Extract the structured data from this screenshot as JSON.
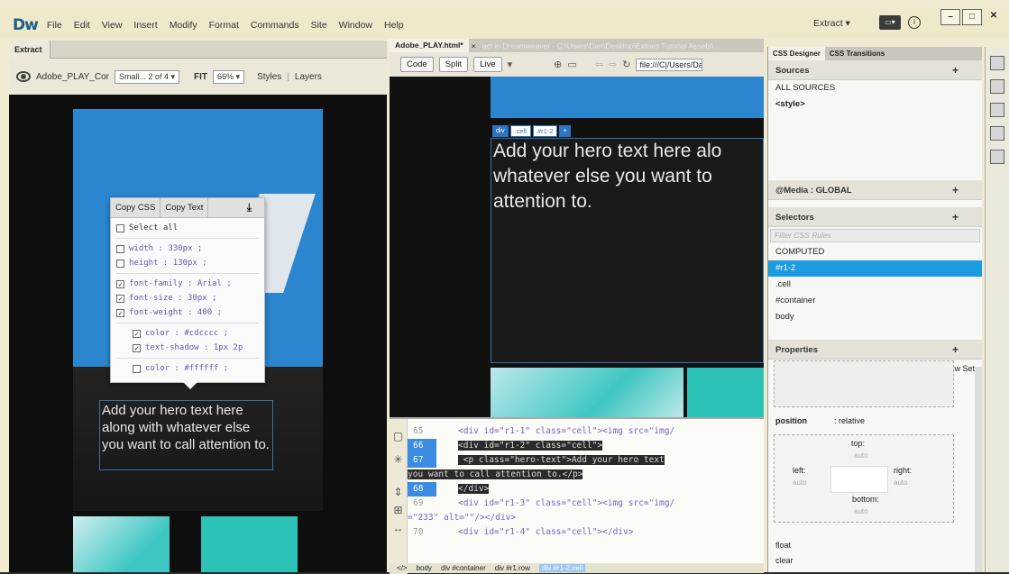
{
  "app": {
    "logo": "Dw"
  },
  "menu": [
    "File",
    "Edit",
    "View",
    "Insert",
    "Modify",
    "Format",
    "Commands",
    "Site",
    "Window",
    "Help"
  ],
  "workspace": {
    "label": "Extract ▾"
  },
  "extract_panel": {
    "tab": "Extract",
    "file": "Adobe_PLAY_Cor",
    "size_select": "Small... 2 of 4 ▾",
    "fit": "FIT",
    "zoom": "66% ▾",
    "styles": "Styles",
    "layers": "Layers",
    "hero_text": "Add your hero text here along with whatever else you want to call attention to.",
    "popup": {
      "copy_css": "Copy CSS",
      "copy_text": "Copy Text",
      "select_all": "Select all",
      "props": [
        {
          "text": "width : 330px ;",
          "checked": false
        },
        {
          "text": "height : 130px ;",
          "checked": false
        },
        {
          "text": "font-family : Arial ;",
          "checked": true
        },
        {
          "text": "font-size : 30px ;",
          "checked": true
        },
        {
          "text": "font-weight : 400 ;",
          "checked": true
        }
      ],
      "sub_props": [
        {
          "text": "color : #cdcccc ;",
          "checked": true
        },
        {
          "text": "text-shadow : 1px 2p",
          "checked": true
        }
      ],
      "last": {
        "text": "color : #ffffff ;",
        "checked": false
      }
    }
  },
  "doc": {
    "tab": "Adobe_PLAY.html*",
    "path": "act in Dreamweaver - C:\\Users\\Dan\\Desktop\\Extract Tutorial Assets\\...",
    "code_btn": "Code",
    "split_btn": "Split",
    "live_btn": "Live",
    "address": "file:///C|/Users/Dan",
    "tag_div": "div",
    "tag_cell": ".cell",
    "tag_id": "#r1-2",
    "tag_plus": "+",
    "hero_lines": [
      "Add your hero text here alo",
      "whatever else you want to",
      "attention to."
    ],
    "code_lines": [
      {
        "n": "65",
        "t": "<div id=\"r1-1\" class=\"cell\"><img src=\"img/"
      },
      {
        "n": "66",
        "t": "<div id=\"r1-2\" class=\"cell\">"
      },
      {
        "n": "67",
        "t": "  <p class=\"hero-text\">Add your hero text"
      },
      {
        "n": "",
        "t": "you want to call attention to.</p>"
      },
      {
        "n": "68",
        "t": "</div>"
      },
      {
        "n": "69",
        "t": "<div id=\"r1-3\" class=\"cell\"><img src=\"img/"
      },
      {
        "n": "",
        "t": "=\"233\" alt=\"\"/></div>"
      },
      {
        "n": "70",
        "t": "<div id=\"r1-4\" class=\"cell\"></div>"
      }
    ],
    "status": [
      "</>",
      "body",
      "div #container",
      "div #r1.row",
      "div #r1-2.cell"
    ]
  },
  "css_panel": {
    "tab1": "CSS Designer",
    "tab2": "CSS Transitions",
    "sources": "Sources",
    "all_sources": "ALL SOURCES",
    "style": "<style>",
    "media": "@Media : GLOBAL",
    "selectors": "Selectors",
    "filter": "Filter CSS Rules",
    "selector_items": [
      "COMPUTED",
      "#r1-2",
      ".cell",
      "#container",
      "body"
    ],
    "properties": "Properties",
    "show_set": "Show Set",
    "position_label": "position",
    "position_value": ": relative",
    "top": "top:",
    "left": "left:",
    "right": "right:",
    "bottom": "bottom:",
    "auto": "auto",
    "float": "float",
    "clear": "clear"
  }
}
